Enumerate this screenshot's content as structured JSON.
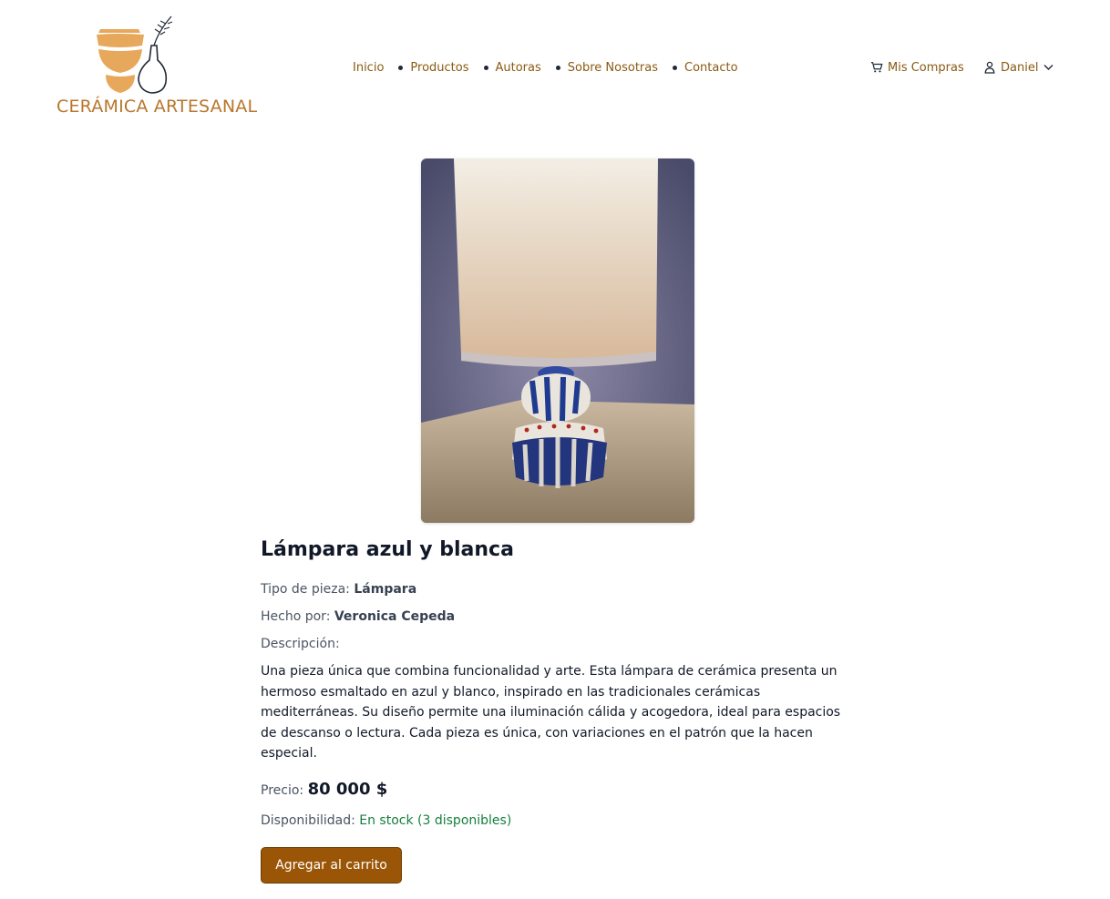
{
  "brand": {
    "name": "CERÁMICA ARTESANAL"
  },
  "nav": {
    "items": [
      {
        "label": "Inicio"
      },
      {
        "label": "Productos"
      },
      {
        "label": "Autoras"
      },
      {
        "label": "Sobre Nosotras"
      },
      {
        "label": "Contacto"
      }
    ]
  },
  "header_actions": {
    "cart_label": "Mis Compras",
    "cart_icon": "cart-icon",
    "user_label": "Daniel",
    "user_icon": "user-icon"
  },
  "product": {
    "title": "Lámpara azul y blanca",
    "type_label": "Tipo de pieza:",
    "type_value": "Lámpara",
    "maker_label": "Hecho por:",
    "maker_value": "Veronica Cepeda",
    "description_label": "Descripción:",
    "description": "Una pieza única que combina funcionalidad y arte. Esta lámpara de cerámica presenta un hermoso esmaltado en azul y blanco, inspirado en las tradicionales cerámicas mediterráneas. Su diseño permite una iluminación cálida y acogedora, ideal para espacios de descanso o lectura. Cada pieza es única, con variaciones en el patrón que la hacen especial.",
    "price_label": "Precio:",
    "price_value": "80 000 $",
    "availability_label": "Disponibilidad:",
    "availability_value": "En stock (3 disponibles)",
    "add_to_cart_label": "Agregar al carrito"
  },
  "colors": {
    "accent": "#9a5606",
    "nav_text": "#8a5a12",
    "logo": "#b8762c",
    "in_stock": "#15803d"
  }
}
